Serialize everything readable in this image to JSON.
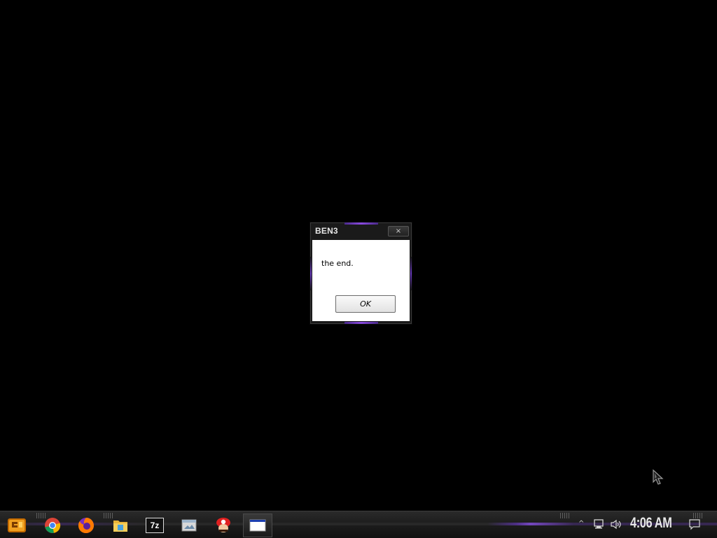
{
  "dialog": {
    "title": "BEN3",
    "close_label": "×",
    "message": "the end.",
    "ok_label": "OK"
  },
  "taskbar": {
    "pinned": [
      {
        "name": "start",
        "icon": "start-menu-icon"
      },
      {
        "name": "chrome",
        "icon": "chrome-icon"
      },
      {
        "name": "firefox",
        "icon": "firefox-icon"
      },
      {
        "name": "file-explorer",
        "icon": "folder-icon"
      },
      {
        "name": "7zip",
        "icon": "7zip-icon",
        "label": "7z"
      },
      {
        "name": "app-window",
        "icon": "window-icon"
      },
      {
        "name": "mario",
        "icon": "mario-icon"
      },
      {
        "name": "active-window",
        "icon": "blank-window-icon"
      }
    ],
    "tray": {
      "chevron": "^",
      "network_icon": "network-icon",
      "volume_icon": "volume-icon",
      "clock": "4:06 AM",
      "notification_icon": "notification-icon"
    }
  },
  "colors": {
    "desktop_bg": "#000000",
    "accent_purple": "#8a52e6",
    "dialog_frame": "#1a1a1a"
  }
}
